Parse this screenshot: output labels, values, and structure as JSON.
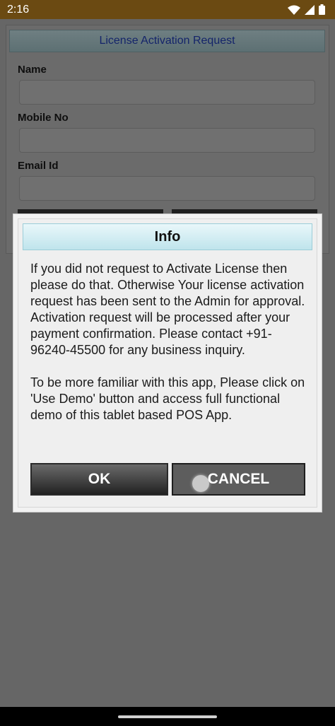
{
  "status_bar": {
    "time": "2:16",
    "icons": [
      "wifi-icon",
      "signal-icon",
      "battery-icon"
    ]
  },
  "form": {
    "title": "License Activation Request",
    "fields": [
      {
        "label": "Name",
        "value": ""
      },
      {
        "label": "Mobile No",
        "value": ""
      },
      {
        "label": "Email Id",
        "value": ""
      }
    ]
  },
  "dialog": {
    "title": "Info",
    "message": "If you did not request to Activate License then please do that. Otherwise Your license activation request has been sent to the Admin for approval. Activation request will be processed after your payment confirmation. Please contact +91-96240-45500 for any business inquiry.\n\nTo be more familiar with this app, Please click on 'Use Demo' button and access full functional demo of this tablet based POS App.",
    "ok_label": "OK",
    "cancel_label": "CANCEL"
  },
  "colors": {
    "status_bar": "#6b4a12",
    "overlay": "#666666",
    "dialog_title_bg": "#bfe4ec",
    "form_title_text": "#14246a"
  }
}
